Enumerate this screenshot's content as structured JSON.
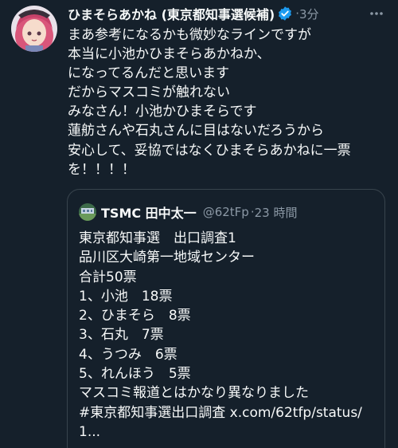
{
  "tweet": {
    "author_name": "ひまそらあかね (東京都知事選候補)",
    "dot": "·",
    "time": "3分",
    "lines": [
      "まあ参考になるかも微妙なラインですが",
      "本当に小池かひまそらあかねか、",
      "になってるんだと思います",
      "だからマスコミが触れない",
      "みなさん！小池かひまそらです",
      "蓮舫さんや石丸さんに目はないだろうから",
      "安心して、妥協ではなくひまそらあかねに一票",
      "を！！！！"
    ]
  },
  "quote": {
    "author_name": "TSMC 田中太一",
    "handle": "@62tFp",
    "dot": "·",
    "time": "23 時間",
    "lines": [
      "東京都知事選　出口調査1",
      "品川区大崎第一地域センター",
      "合計50票",
      "1、小池　18票",
      "2、ひまそら　8票",
      "3、石丸　7票",
      "4、うつみ　6票",
      "5、れんほう　5票",
      "マスコミ報道とはかなり異なりました",
      "#東京都知事選出口調査 x.com/62tfp/status/",
      "1..."
    ]
  },
  "icons": {
    "verified": "verified-badge-icon",
    "more": "more-options-icon"
  },
  "colors": {
    "background": "#15202b",
    "text": "#f7f9f9",
    "secondary": "#8b98a5",
    "verified": "#1d9bf0",
    "border": "#38444d"
  }
}
